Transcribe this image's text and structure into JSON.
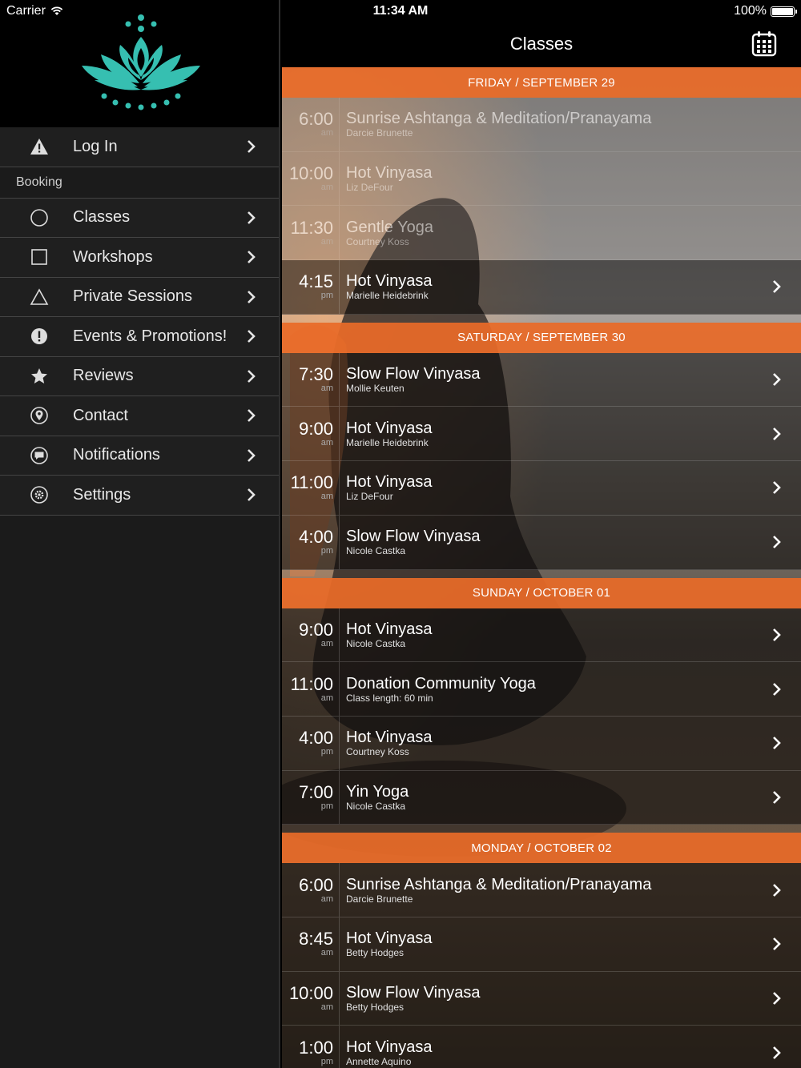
{
  "status_bar": {
    "carrier": "Carrier",
    "time": "11:34 AM",
    "battery": "100%"
  },
  "sidebar": {
    "logo_icon": "lotus-logo-icon",
    "accent_color": "#36bfb1",
    "items_top": [
      {
        "label": "Log In",
        "icon": "warning-icon"
      }
    ],
    "section_label": "Booking",
    "items": [
      {
        "label": "Classes",
        "icon": "circle-icon"
      },
      {
        "label": "Workshops",
        "icon": "square-icon"
      },
      {
        "label": "Private Sessions",
        "icon": "triangle-icon"
      },
      {
        "label": "Events & Promotions!",
        "icon": "exclamation-icon"
      },
      {
        "label": "Reviews",
        "icon": "star-icon"
      },
      {
        "label": "Contact",
        "icon": "location-pin-icon"
      },
      {
        "label": "Notifications",
        "icon": "chat-bubble-icon"
      },
      {
        "label": "Settings",
        "icon": "gear-icon"
      }
    ]
  },
  "header": {
    "title": "Classes",
    "calendar_icon": "calendar-icon"
  },
  "schedule_accent": "#e86a28",
  "days": [
    {
      "label": "FRIDAY / SEPTEMBER 29",
      "classes": [
        {
          "time": "6:00",
          "ampm": "am",
          "name": "Sunrise Ashtanga & Meditation/Pranayama",
          "sub": "Darcie Brunette",
          "past": true
        },
        {
          "time": "10:00",
          "ampm": "am",
          "name": "Hot Vinyasa",
          "sub": "Liz DeFour",
          "past": true
        },
        {
          "time": "11:30",
          "ampm": "am",
          "name": "Gentle Yoga",
          "sub": "Courtney Koss",
          "past": true
        },
        {
          "time": "4:15",
          "ampm": "pm",
          "name": "Hot Vinyasa",
          "sub": "Marielle Heidebrink",
          "past": false
        }
      ]
    },
    {
      "label": "SATURDAY / SEPTEMBER 30",
      "classes": [
        {
          "time": "7:30",
          "ampm": "am",
          "name": "Slow Flow Vinyasa",
          "sub": "Mollie Keuten",
          "past": false
        },
        {
          "time": "9:00",
          "ampm": "am",
          "name": "Hot Vinyasa",
          "sub": "Marielle Heidebrink",
          "past": false
        },
        {
          "time": "11:00",
          "ampm": "am",
          "name": "Hot Vinyasa",
          "sub": "Liz DeFour",
          "past": false
        },
        {
          "time": "4:00",
          "ampm": "pm",
          "name": "Slow Flow Vinyasa",
          "sub": "Nicole Castka",
          "past": false
        }
      ]
    },
    {
      "label": "SUNDAY / OCTOBER 01",
      "classes": [
        {
          "time": "9:00",
          "ampm": "am",
          "name": "Hot Vinyasa",
          "sub": "Nicole Castka",
          "past": false
        },
        {
          "time": "11:00",
          "ampm": "am",
          "name": "Donation Community Yoga",
          "sub": "Class length: 60 min",
          "past": false
        },
        {
          "time": "4:00",
          "ampm": "pm",
          "name": "Hot Vinyasa",
          "sub": "Courtney Koss",
          "past": false
        },
        {
          "time": "7:00",
          "ampm": "pm",
          "name": "Yin Yoga",
          "sub": "Nicole Castka",
          "past": false
        }
      ]
    },
    {
      "label": "MONDAY / OCTOBER 02",
      "classes": [
        {
          "time": "6:00",
          "ampm": "am",
          "name": "Sunrise Ashtanga & Meditation/Pranayama",
          "sub": "Darcie Brunette",
          "past": false
        },
        {
          "time": "8:45",
          "ampm": "am",
          "name": "Hot Vinyasa",
          "sub": "Betty Hodges",
          "past": false
        },
        {
          "time": "10:00",
          "ampm": "am",
          "name": "Slow Flow Vinyasa",
          "sub": "Betty Hodges",
          "past": false
        },
        {
          "time": "1:00",
          "ampm": "pm",
          "name": "Hot Vinyasa",
          "sub": "Annette Aquino",
          "past": false
        }
      ]
    }
  ]
}
